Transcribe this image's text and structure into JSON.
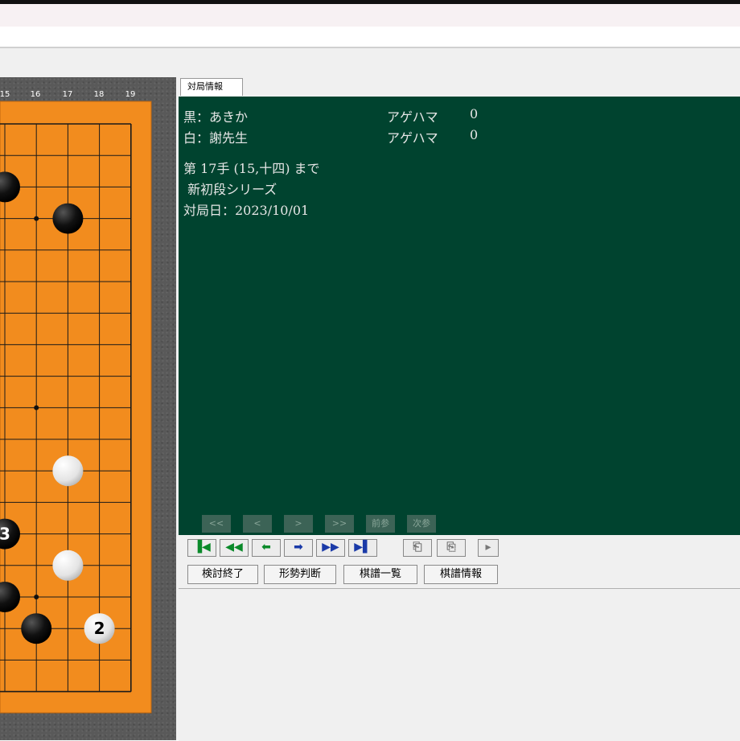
{
  "game": {
    "col_labels": [
      "15",
      "16",
      "17",
      "18",
      "19"
    ],
    "stones": [
      {
        "color": "black",
        "x": 0,
        "y": 2,
        "label": ""
      },
      {
        "color": "black",
        "x": 2,
        "y": 3,
        "label": ""
      },
      {
        "color": "white",
        "x": 2,
        "y": 11,
        "label": ""
      },
      {
        "color": "black",
        "x": 0,
        "y": 13,
        "label": "3"
      },
      {
        "color": "white",
        "x": 2,
        "y": 14,
        "label": ""
      },
      {
        "color": "black",
        "x": 0,
        "y": 15,
        "label": ""
      },
      {
        "color": "black",
        "x": 1,
        "y": 16,
        "label": ""
      },
      {
        "color": "white",
        "x": 3,
        "y": 16,
        "label": "2"
      }
    ],
    "hoshi": [
      {
        "x": 1,
        "y": 3
      },
      {
        "x": 1,
        "y": 9
      },
      {
        "x": 1,
        "y": 15
      }
    ]
  },
  "tab": {
    "label": "対局情報"
  },
  "info": {
    "black_label": "黒：あきか",
    "black_cap_label": "アゲハマ",
    "black_captures": "0",
    "white_label": "白：謝先生",
    "white_cap_label": "アゲハマ",
    "white_captures": "0",
    "move_text": "第 17手 (15,十四) まで",
    "series": " 新初段シリーズ",
    "date": "対局日：2023/10/01"
  },
  "comment_nav": {
    "first": "<<",
    "prev": "<",
    "next": ">",
    "last": ">>",
    "prev_ref": "前参",
    "next_ref": "次参"
  },
  "nav": {
    "first": "▐◀",
    "fast_back": "◀◀",
    "back": "⬅",
    "forward": "➡",
    "fast_forward": "▶▶",
    "last": "▶▌",
    "comment_a": "⎗",
    "comment_b": "⎘",
    "play": "▸"
  },
  "actions": {
    "end_review": "検討終了",
    "judge": "形勢判断",
    "record_list": "棋譜一覧",
    "record_info": "棋譜情報"
  }
}
